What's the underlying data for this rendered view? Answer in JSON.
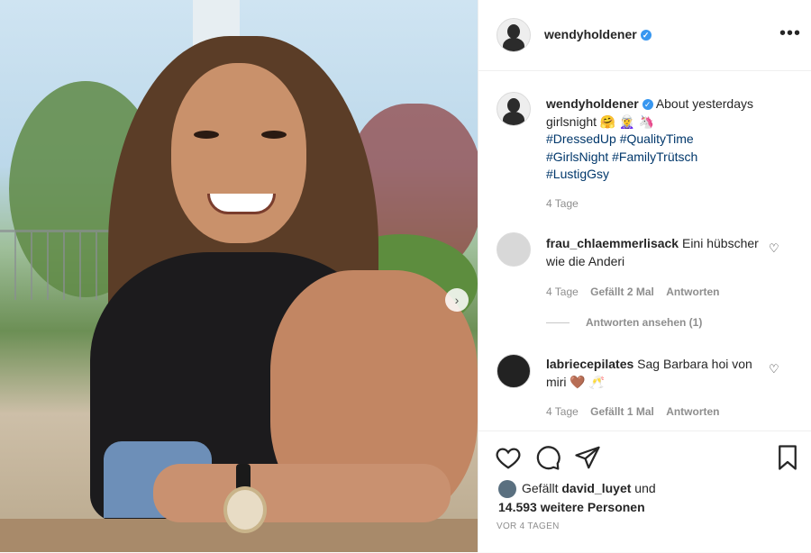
{
  "post": {
    "username": "wendyholdener",
    "verified": true
  },
  "caption": {
    "username": "wendyholdener",
    "text": "About yesterdays girlsnight 🤗 🧝‍♀️ 🦄",
    "hashtags_line1": "#DressedUp #QualityTime",
    "hashtags_line2": "#GirlsNight #FamilyTrütsch",
    "hashtags_line3": "#LustigGsy",
    "age": "4 Tage"
  },
  "comments": [
    {
      "username": "frau_chlaemmerlisack",
      "text": "Eini hübscher wie die Anderi",
      "age": "4 Tage",
      "likes": "Gefällt 2 Mal",
      "reply": "Antworten",
      "view_replies": "Antworten ansehen (1)"
    },
    {
      "username": "labriecepilates",
      "text": "Sag Barbara hoi von miri 🤎 🥂",
      "age": "4 Tage",
      "likes": "Gefällt 1 Mal",
      "reply": "Antworten"
    }
  ],
  "likes": {
    "prefix": "Gefällt",
    "user": "david_luyet",
    "suffix": "und",
    "others": "14.593 weitere Personen"
  },
  "date": "VOR 4 TAGEN",
  "icons": [
    "heart-icon",
    "comment-icon",
    "share-icon",
    "bookmark-icon",
    "more-icon",
    "verified-icon",
    "chevron-right-icon"
  ],
  "colors": {
    "verified": "#3897f0",
    "hashtag": "#00376b",
    "meta": "#8e8e8e"
  }
}
